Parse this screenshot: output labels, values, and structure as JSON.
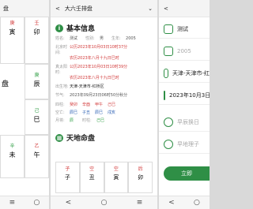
{
  "left_panel": {
    "title": "盘",
    "cells": [
      {
        "top": "庚",
        "main": "寅",
        "side": "",
        "cls": "red"
      },
      {
        "top": "壬",
        "main": "卯",
        "side": "",
        "cls": "red"
      },
      {
        "top": "",
        "main": "",
        "side": "",
        "cls": ""
      },
      {
        "top": "",
        "main": "辰",
        "side": "庚",
        "cls": "green"
      },
      {
        "top": "",
        "main": "巳",
        "side": "己",
        "cls": "green"
      },
      {
        "top": "",
        "main": "未",
        "side": "辛",
        "cls": "green"
      },
      {
        "top": "",
        "main": "午",
        "side": "乙",
        "cls": "red"
      }
    ],
    "left_label": "盘"
  },
  "middle_panel": {
    "title": "大六壬排盘",
    "dropdown_icon": "chevron-down-icon",
    "section1_title": "基本信息",
    "name_label": "姓名:",
    "name_value": "测试",
    "gender_label": "性别:",
    "gender_value": "男",
    "birth_label": "生年:",
    "birth_value": "2005",
    "gongli_label": "北京时间:",
    "gongli_value": "公历2023年10月03日10时37分",
    "nongli_value": "农历2023年八月十九日巳时",
    "zhenshi_label": "真太阳时:",
    "zhenshi_value": "公历2023年10月03日10时39分",
    "zhenshi_nongli": "农历2023年八月十九日巳时",
    "place_label": "出生地:",
    "place_value": "天津-天津市-红桥区",
    "jieqi_label": "节气:",
    "jieqi_value": "2023年09月23日06时50分秋分",
    "sizhu_label": "四柱:",
    "sizhu": [
      "癸卯",
      "辛酉",
      "甲午",
      "己巳"
    ],
    "kongwang_label": "空亡:",
    "kongwang": [
      "辰巳",
      "子丑",
      "辰巳",
      "戌亥"
    ],
    "yuejiang_label": "月将:",
    "yuejiang": "辰",
    "shizhu_label": "时柱:",
    "shizhu": "己巳",
    "section2_title": "天地命盘",
    "tiandi": [
      {
        "top": "子",
        "bottom": "子",
        "cls": "red"
      },
      {
        "top": "空",
        "bottom": "丑",
        "cls": "red"
      },
      {
        "top": "空",
        "bottom": "寅",
        "cls": "red"
      },
      {
        "top": "后",
        "bottom": "卯",
        "cls": "red"
      }
    ]
  },
  "right_panel": {
    "fields": [
      {
        "icon": "user-icon",
        "value": "测试"
      },
      {
        "icon": "calendar-icon",
        "value": "2005"
      },
      {
        "icon": "location-icon",
        "value": "天津-天津市-红"
      },
      {
        "icon": "calendar-icon",
        "value": "2023年10月3日"
      },
      {
        "icon": "check-icon",
        "value": "早辰换日"
      },
      {
        "icon": "check-icon",
        "value": "早地理子"
      }
    ],
    "button": "立即"
  },
  "nav": {
    "back": "<",
    "home": "○",
    "menu": "≡"
  }
}
